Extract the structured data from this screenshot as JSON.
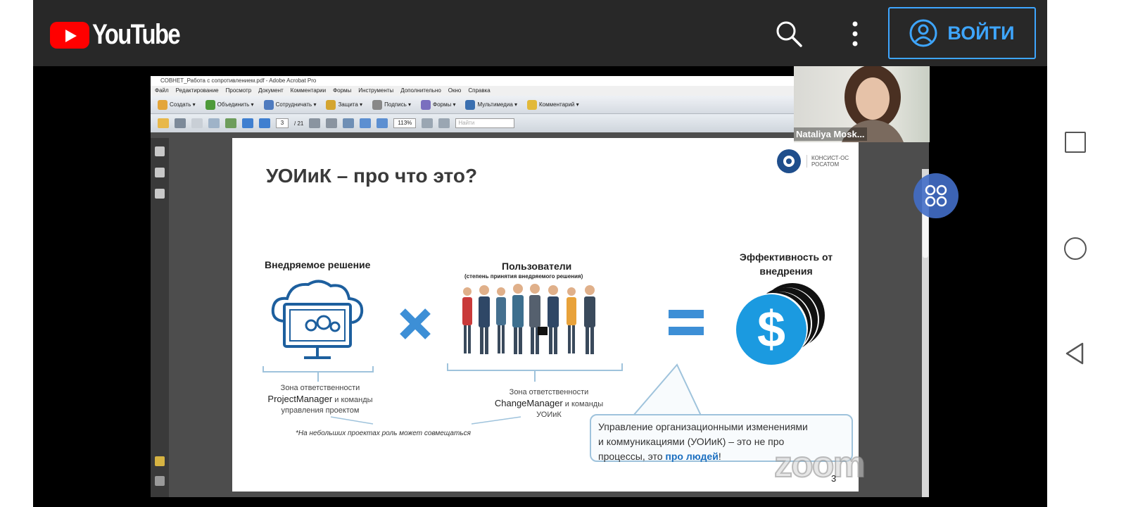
{
  "youtube": {
    "logo_text": "YouTube",
    "signin_label": "ВОЙТИ",
    "icons": [
      "search-icon",
      "more-vert-icon",
      "account-circle-icon",
      "youtube-play-icon"
    ]
  },
  "acrobat": {
    "window_title": "СОВНЕТ_Работа с сопротивлением.pdf - Adobe Acrobat Pro",
    "menu": [
      "Файл",
      "Редактирование",
      "Просмотр",
      "Документ",
      "Комментарии",
      "Формы",
      "Инструменты",
      "Дополнительно",
      "Окно",
      "Справка"
    ],
    "toolbar": [
      "Создать",
      "Объединить",
      "Сотрудничать",
      "Защита",
      "Подпись",
      "Формы",
      "Мультимедиа",
      "Комментарий"
    ],
    "page_current": "3",
    "page_total": "/ 21",
    "zoom": "113%",
    "find_placeholder": "Найти"
  },
  "slide": {
    "title": "УОИиК – про что это?",
    "logo_line1": "КОНСИСТ-ОС",
    "logo_line2": "РОСАТОМ",
    "impl_heading": "Внедряемое решение",
    "users_heading": "Пользователи",
    "users_sub": "(степень принятия внедряемого решения)",
    "eff_heading_line1": "Эффективность от",
    "eff_heading_line2": "внедрения",
    "zone1_line1": "Зона ответственности",
    "zone1_strong": "ProjectManager",
    "zone1_rest": " и команды",
    "zone1_line3": "управления проектом",
    "zone2_line1": "Зона ответственности",
    "zone2_strong": "ChangeManager",
    "zone2_rest": " и команды",
    "zone2_line3": "УОИиК",
    "note": "*На небольших проектах роль может совмещаться",
    "callout_line1": "Управление организационными изменениями",
    "callout_line2": "и коммуникациями (УОИиК) – это не про",
    "callout_line3_pre": "процессы, это ",
    "callout_line3_hl": "про людей",
    "callout_line3_post": "!",
    "page_number": "3",
    "zoom_watermark": "zoom"
  },
  "webcam": {
    "participant_name": "Nataliya Mosk..."
  },
  "colors": {
    "youtube_red": "#ff0000",
    "signin_blue": "#3ea6ff",
    "slide_accent": "#1b9ae0"
  },
  "android_nav": [
    "recents-square-icon",
    "home-circle-icon",
    "back-triangle-icon"
  ]
}
